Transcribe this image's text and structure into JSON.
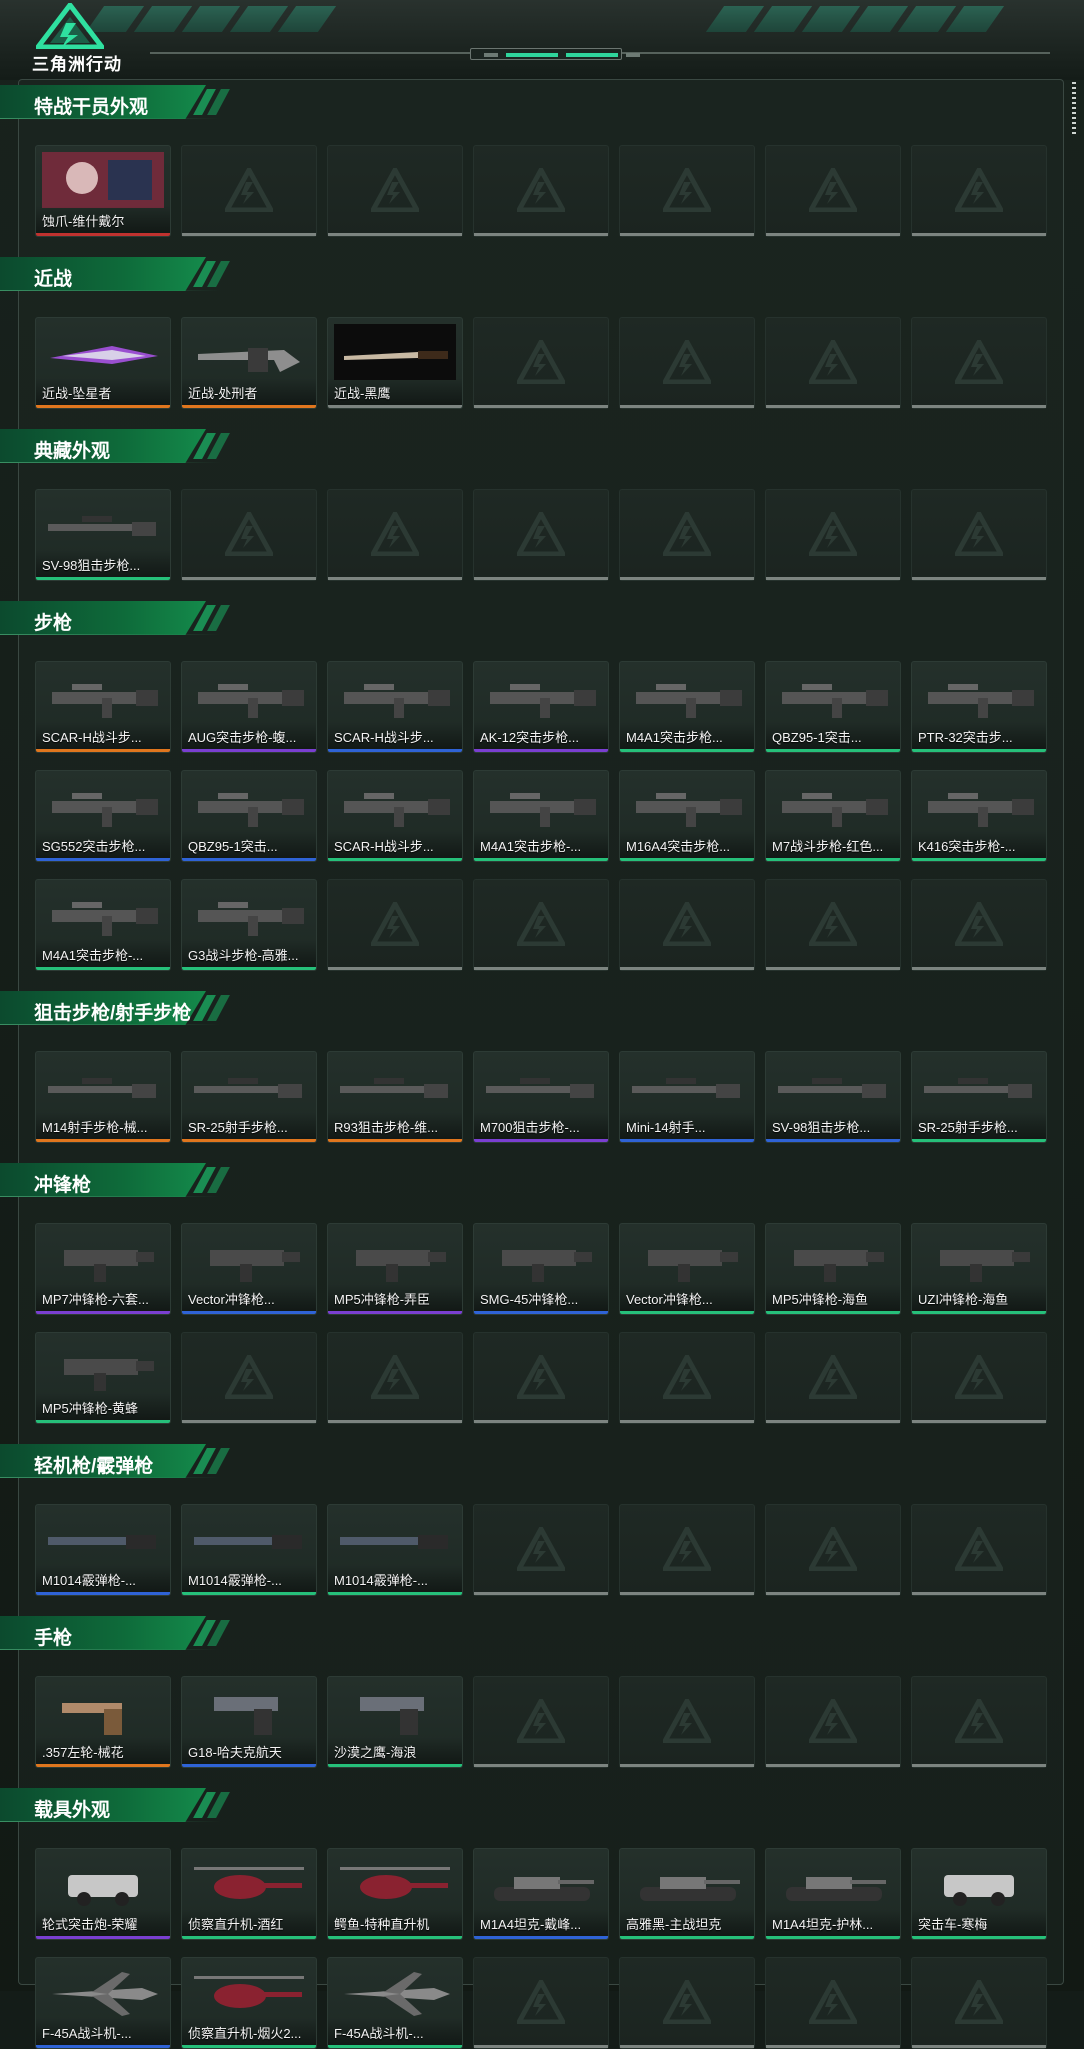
{
  "app": {
    "logo_text": "三角洲行动"
  },
  "colors": {
    "red": "#c0322f",
    "orange": "#e0761e",
    "purple": "#7a3fd1",
    "blue": "#2f63d6",
    "green": "#26c07a",
    "gray": "#7c8480"
  },
  "sections": [
    {
      "title": "特战干员外观",
      "rows": [
        [
          {
            "label": "蚀爪-维什戴尔",
            "rarity": "red",
            "icon": "operator-portrait-icon"
          },
          null,
          null,
          null,
          null,
          null,
          null
        ]
      ]
    },
    {
      "title": "近战",
      "rows": [
        [
          {
            "label": "近战-坠星者",
            "rarity": "orange",
            "icon": "melee-blade-icon"
          },
          {
            "label": "近战-处刑者",
            "rarity": "orange",
            "icon": "melee-axe-icon"
          },
          {
            "label": "近战-黑鹰",
            "rarity": "gray",
            "icon": "melee-knife-icon"
          },
          null,
          null,
          null,
          null
        ]
      ]
    },
    {
      "title": "典藏外观",
      "rows": [
        [
          {
            "label": "SV-98狙击步枪...",
            "rarity": "green",
            "icon": "sniper-rifle-icon"
          },
          null,
          null,
          null,
          null,
          null,
          null
        ]
      ]
    },
    {
      "title": "步枪",
      "rows": [
        [
          {
            "label": "SCAR-H战斗步...",
            "rarity": "orange",
            "icon": "assault-rifle-icon"
          },
          {
            "label": "AUG突击步枪-蝮...",
            "rarity": "purple",
            "icon": "assault-rifle-icon"
          },
          {
            "label": "SCAR-H战斗步...",
            "rarity": "blue",
            "icon": "assault-rifle-icon"
          },
          {
            "label": "AK-12突击步枪...",
            "rarity": "purple",
            "icon": "assault-rifle-icon"
          },
          {
            "label": "M4A1突击步枪...",
            "rarity": "green",
            "icon": "assault-rifle-icon"
          },
          {
            "label": "QBZ95-1突击...",
            "rarity": "green",
            "icon": "assault-rifle-icon"
          },
          {
            "label": "PTR-32突击步...",
            "rarity": "green",
            "icon": "assault-rifle-icon"
          }
        ],
        [
          {
            "label": "SG552突击步枪...",
            "rarity": "blue",
            "icon": "assault-rifle-icon"
          },
          {
            "label": "QBZ95-1突击...",
            "rarity": "blue",
            "icon": "assault-rifle-icon"
          },
          {
            "label": "SCAR-H战斗步...",
            "rarity": "green",
            "icon": "assault-rifle-icon"
          },
          {
            "label": "M4A1突击步枪-...",
            "rarity": "green",
            "icon": "assault-rifle-icon"
          },
          {
            "label": "M16A4突击步枪...",
            "rarity": "green",
            "icon": "assault-rifle-icon"
          },
          {
            "label": "M7战斗步枪-红色...",
            "rarity": "green",
            "icon": "assault-rifle-icon"
          },
          {
            "label": "K416突击步枪-...",
            "rarity": "green",
            "icon": "assault-rifle-icon"
          }
        ],
        [
          {
            "label": "M4A1突击步枪-...",
            "rarity": "green",
            "icon": "assault-rifle-icon"
          },
          {
            "label": "G3战斗步枪-高雅...",
            "rarity": "green",
            "icon": "assault-rifle-icon"
          },
          null,
          null,
          null,
          null,
          null
        ]
      ]
    },
    {
      "title": "狙击步枪/射手步枪",
      "rows": [
        [
          {
            "label": "M14射手步枪-械...",
            "rarity": "orange",
            "icon": "sniper-rifle-icon"
          },
          {
            "label": "SR-25射手步枪...",
            "rarity": "orange",
            "icon": "sniper-rifle-icon"
          },
          {
            "label": "R93狙击步枪-维...",
            "rarity": "orange",
            "icon": "sniper-rifle-icon"
          },
          {
            "label": "M700狙击步枪-...",
            "rarity": "purple",
            "icon": "sniper-rifle-icon"
          },
          {
            "label": "Mini-14射手...",
            "rarity": "blue",
            "icon": "sniper-rifle-icon"
          },
          {
            "label": "SV-98狙击步枪...",
            "rarity": "blue",
            "icon": "sniper-rifle-icon"
          },
          {
            "label": "SR-25射手步枪...",
            "rarity": "green",
            "icon": "sniper-rifle-icon"
          }
        ]
      ]
    },
    {
      "title": "冲锋枪",
      "rows": [
        [
          {
            "label": "MP7冲锋枪-六套...",
            "rarity": "purple",
            "icon": "smg-icon"
          },
          {
            "label": "Vector冲锋枪...",
            "rarity": "blue",
            "icon": "smg-icon"
          },
          {
            "label": "MP5冲锋枪-弄臣",
            "rarity": "purple",
            "icon": "smg-icon"
          },
          {
            "label": "SMG-45冲锋枪...",
            "rarity": "blue",
            "icon": "smg-icon"
          },
          {
            "label": "Vector冲锋枪...",
            "rarity": "green",
            "icon": "smg-icon"
          },
          {
            "label": "MP5冲锋枪-海鱼",
            "rarity": "green",
            "icon": "smg-icon"
          },
          {
            "label": "UZI冲锋枪-海鱼",
            "rarity": "green",
            "icon": "smg-icon"
          }
        ],
        [
          {
            "label": "MP5冲锋枪-黄蜂",
            "rarity": "green",
            "icon": "smg-icon"
          },
          null,
          null,
          null,
          null,
          null,
          null
        ]
      ]
    },
    {
      "title": "轻机枪/霰弹枪",
      "rows": [
        [
          {
            "label": "M1014霰弹枪-...",
            "rarity": "blue",
            "icon": "shotgun-icon"
          },
          {
            "label": "M1014霰弹枪-...",
            "rarity": "green",
            "icon": "shotgun-icon"
          },
          {
            "label": "M1014霰弹枪-...",
            "rarity": "green",
            "icon": "shotgun-icon"
          },
          null,
          null,
          null,
          null
        ]
      ]
    },
    {
      "title": "手枪",
      "rows": [
        [
          {
            "label": ".357左轮-械花",
            "rarity": "orange",
            "icon": "revolver-icon"
          },
          {
            "label": "G18-哈夫克航天",
            "rarity": "blue",
            "icon": "pistol-icon"
          },
          {
            "label": "沙漠之鹰-海浪",
            "rarity": "green",
            "icon": "pistol-icon"
          },
          null,
          null,
          null,
          null
        ]
      ]
    },
    {
      "title": "载具外观",
      "rows": [
        [
          {
            "label": "轮式突击炮-荣耀",
            "rarity": "purple",
            "icon": "armored-vehicle-icon"
          },
          {
            "label": "侦察直升机-酒红",
            "rarity": "green",
            "icon": "helicopter-icon"
          },
          {
            "label": "鳄鱼-特种直升机",
            "rarity": "green",
            "icon": "helicopter-icon"
          },
          {
            "label": "M1A4坦克-戴峰...",
            "rarity": "blue",
            "icon": "tank-icon"
          },
          {
            "label": "高雅黑-主战坦克",
            "rarity": "green",
            "icon": "tank-icon"
          },
          {
            "label": "M1A4坦克-护林...",
            "rarity": "green",
            "icon": "tank-icon"
          },
          {
            "label": "突击车-寒梅",
            "rarity": "green",
            "icon": "armored-vehicle-icon"
          }
        ],
        [
          {
            "label": "F-45A战斗机-...",
            "rarity": "blue",
            "icon": "fighter-jet-icon"
          },
          {
            "label": "侦察直升机-烟火2...",
            "rarity": "green",
            "icon": "helicopter-icon"
          },
          {
            "label": "F-45A战斗机-...",
            "rarity": "green",
            "icon": "fighter-jet-icon"
          },
          null,
          null,
          null,
          null
        ]
      ]
    }
  ]
}
